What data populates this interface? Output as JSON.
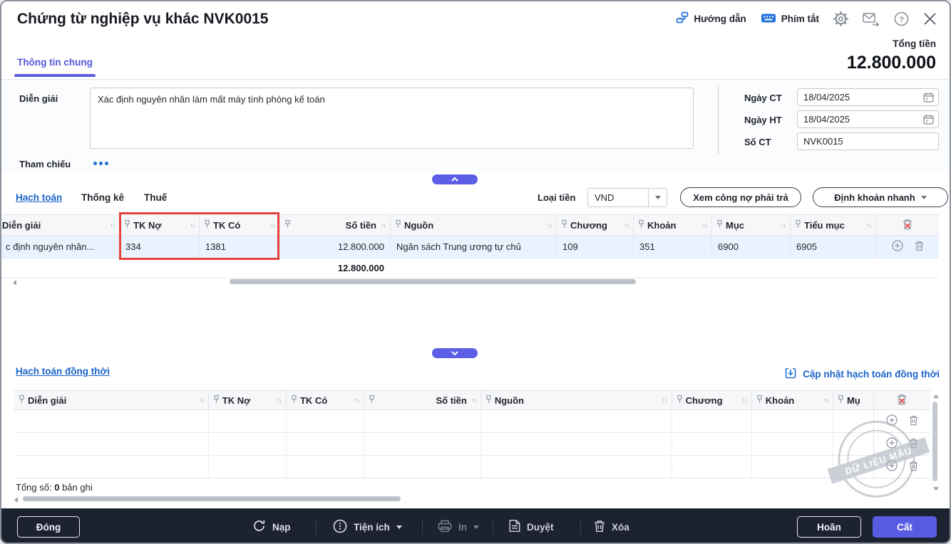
{
  "header": {
    "title": "Chứng từ nghiệp vụ khác NVK0015",
    "guide_label": "Hướng dẫn",
    "shortcut_label": "Phím tắt",
    "total_label": "Tổng tiền",
    "total_value": "12.800.000"
  },
  "tabs": {
    "general_label": "Thông tin chung"
  },
  "form": {
    "description_label": "Diễn giải",
    "description_value": "Xác định nguyên nhân làm mất máy tính phòng kế toán",
    "reference_label": "Tham chiếu",
    "doc_date_label": "Ngày CT",
    "doc_date_value": "18/04/2025",
    "post_date_label": "Ngày HT",
    "post_date_value": "18/04/2025",
    "doc_no_label": "Số CT",
    "doc_no_value": "NVK0015"
  },
  "accounting": {
    "tab_hach_toan": "Hạch toán",
    "tab_thong_ke": "Thống kê",
    "tab_thue": "Thuế",
    "currency_label": "Loại tiền",
    "currency_value": "VND",
    "debt_button": "Xem công nợ phải trả",
    "quick_entry_button": "Định khoản nhanh",
    "columns": {
      "description": "Diễn giải",
      "debit": "TK Nợ",
      "credit": "TK Có",
      "amount": "Số tiền",
      "source": "Nguồn",
      "chapter": "Chương",
      "clause": "Khoản",
      "item": "Mục",
      "sub_item": "Tiểu mục"
    },
    "row": {
      "description": "c định nguyên nhân...",
      "debit": "334",
      "credit": "1381",
      "amount": "12.800.000",
      "source": "Ngân sách Trung ương tự chủ",
      "chapter": "109",
      "clause": "351",
      "item": "6900",
      "sub_item": "6905"
    },
    "total_amount": "12.800.000"
  },
  "simultaneous": {
    "title": "Hạch toán đồng thời",
    "update_link": "Cập nhật hạch toán đồng thời",
    "columns": {
      "description": "Diễn giải",
      "debit": "TK Nợ",
      "credit": "TK Có",
      "amount": "Số tiền",
      "source": "Nguồn",
      "chapter": "Chương",
      "clause": "Khoản",
      "item": "Mụ"
    },
    "watermark": "DỮ LIỆU MẪU",
    "total_label": "Tổng số:",
    "total_count": "0",
    "total_suffix": "bản ghi"
  },
  "footer": {
    "close": "Đóng",
    "reload": "Nạp",
    "utilities": "Tiện ích",
    "print": "In",
    "approve": "Duyệt",
    "delete": "Xóa",
    "postpone": "Hoãn",
    "save": "Cất"
  },
  "colors": {
    "accent": "#5c5fe6",
    "link": "#1a64c8",
    "highlight": "#e8423e",
    "footer_bg": "#1c2230",
    "row_selected": "#eaf3fd"
  }
}
